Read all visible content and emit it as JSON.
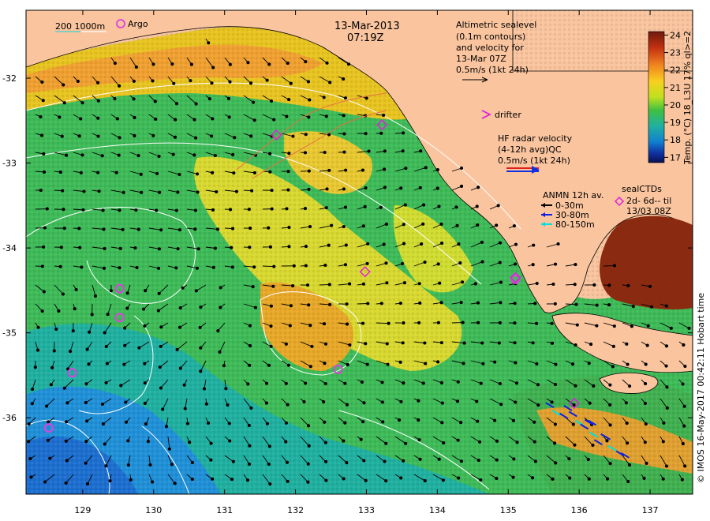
{
  "header": {
    "date": "13-Mar-2013",
    "time": "07:19Z"
  },
  "legend": {
    "depth_contours": "200  1000m",
    "argo": "Argo",
    "altimetry": [
      "Altimetric sealevel",
      "(0.1m contours)",
      "and velocity for",
      "13-Mar 07Z",
      "0.5m/s (1kt 24h)"
    ],
    "drifter": "drifter",
    "hf_radar": [
      "HF radar velocity",
      "(4-12h avg)QC",
      "0.5m/s (1kt 24h)"
    ],
    "anmn": [
      "ANMN 12h av.",
      "0-30m",
      "30-80m",
      "80-150m"
    ],
    "seal_ctds": [
      "sealCTDs",
      "2d- 6d-- til",
      "13/03 08Z"
    ]
  },
  "colorbar": {
    "title": "Temp. (°C) 18_L3U 17% ql>=2",
    "ticks": [
      "24",
      "23",
      "22",
      "21",
      "20",
      "19",
      "18",
      "17"
    ],
    "min": 16.7,
    "max": 24.2
  },
  "credit": "© IMOS 16-May-2017 00:42:11 Hobart time",
  "axes": {
    "x_ticks": [
      "129",
      "130",
      "131",
      "132",
      "133",
      "134",
      "135",
      "136",
      "137"
    ],
    "y_ticks": [
      "-32",
      "-33",
      "-34",
      "-35",
      "-36"
    ],
    "xlim": [
      128.2,
      137.6
    ],
    "ylim": [
      -36.9,
      -31.2
    ]
  },
  "colors": {
    "land": "#f9c49e",
    "argo": "#e040e0",
    "anmn_0_30": "#000000",
    "anmn_30_80": "#1020e0",
    "anmn_80_150": "#00e0e0",
    "hf_radar": "#e02020",
    "drifter": "#e020e0"
  },
  "markers": {
    "argo": [
      {
        "lon": 128.85,
        "lat": -35.47
      },
      {
        "lon": 129.52,
        "lat": -34.48
      },
      {
        "lon": 129.52,
        "lat": -34.82
      },
      {
        "lon": 128.52,
        "lat": -36.12
      },
      {
        "lon": 132.6,
        "lat": -35.43
      },
      {
        "lon": 135.1,
        "lat": -34.37
      }
    ],
    "seal_ctds": [
      {
        "lon": 131.73,
        "lat": -32.67
      },
      {
        "lon": 133.22,
        "lat": -32.55
      },
      {
        "lon": 132.98,
        "lat": -34.28
      },
      {
        "lon": 135.1,
        "lat": -34.35
      },
      {
        "lon": 135.93,
        "lat": -35.83
      }
    ]
  }
}
